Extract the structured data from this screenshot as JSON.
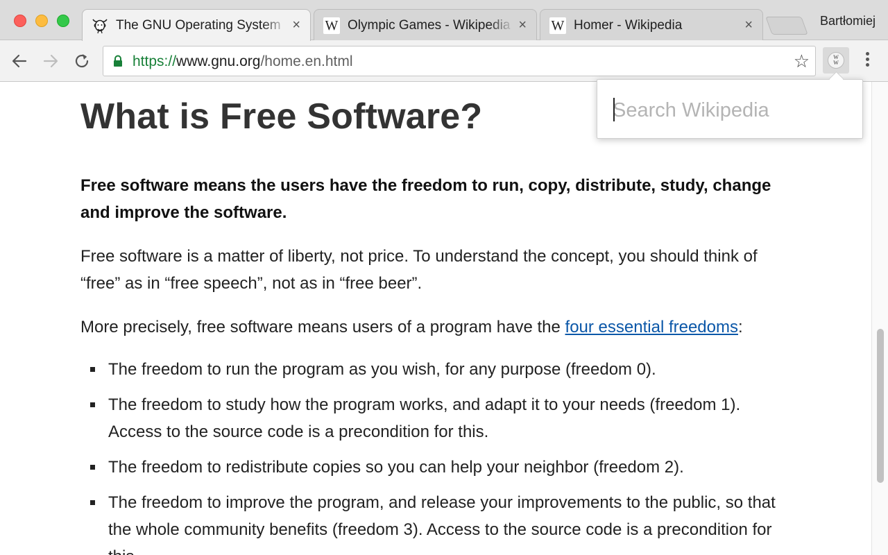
{
  "window": {
    "profile_name": "Bartłomiej"
  },
  "tabs": [
    {
      "title": "The GNU Operating System",
      "favicon": "gnu-head-icon",
      "active": true
    },
    {
      "title": "Olympic Games - Wikipedia",
      "favicon": "wikipedia-w-icon",
      "active": false
    },
    {
      "title": "Homer - Wikipedia",
      "favicon": "wikipedia-w-icon",
      "active": false
    }
  ],
  "tab_icons": {
    "wikipedia_letter": "W",
    "close_glyph": "×"
  },
  "toolbar": {
    "url_scheme": "https://",
    "url_host": "www.gnu.org",
    "url_path": "/home.en.html",
    "bookmark_glyph": "☆",
    "extension_logo_top": "W",
    "extension_logo_bottom": "W"
  },
  "popup": {
    "search_placeholder": "Search Wikipedia",
    "search_value": ""
  },
  "page": {
    "heading": "What is Free Software?",
    "lead": "Free software means the users have the freedom to run, copy, distribute, study, change and improve the software.",
    "para1": "Free software is a matter of liberty, not price. To understand the concept, you should think of “free” as in “free speech”, not as in “free beer”.",
    "para2_before": "More precisely, free software means users of a program have the ",
    "para2_link": "four essential freedoms",
    "para2_after": ":",
    "freedoms": [
      "The freedom to run the program as you wish, for any purpose (freedom 0).",
      "The freedom to study how the program works, and adapt it to your needs (freedom 1). Access to the source code is a precondition for this.",
      "The freedom to redistribute copies so you can help your neighbor (freedom 2).",
      "The freedom to improve the program, and release your improvements to the public, so that the whole community benefits (freedom 3). Access to the source code is a precondition for this."
    ]
  },
  "colors": {
    "secure_green": "#188038",
    "link_blue": "#0b57a8"
  }
}
